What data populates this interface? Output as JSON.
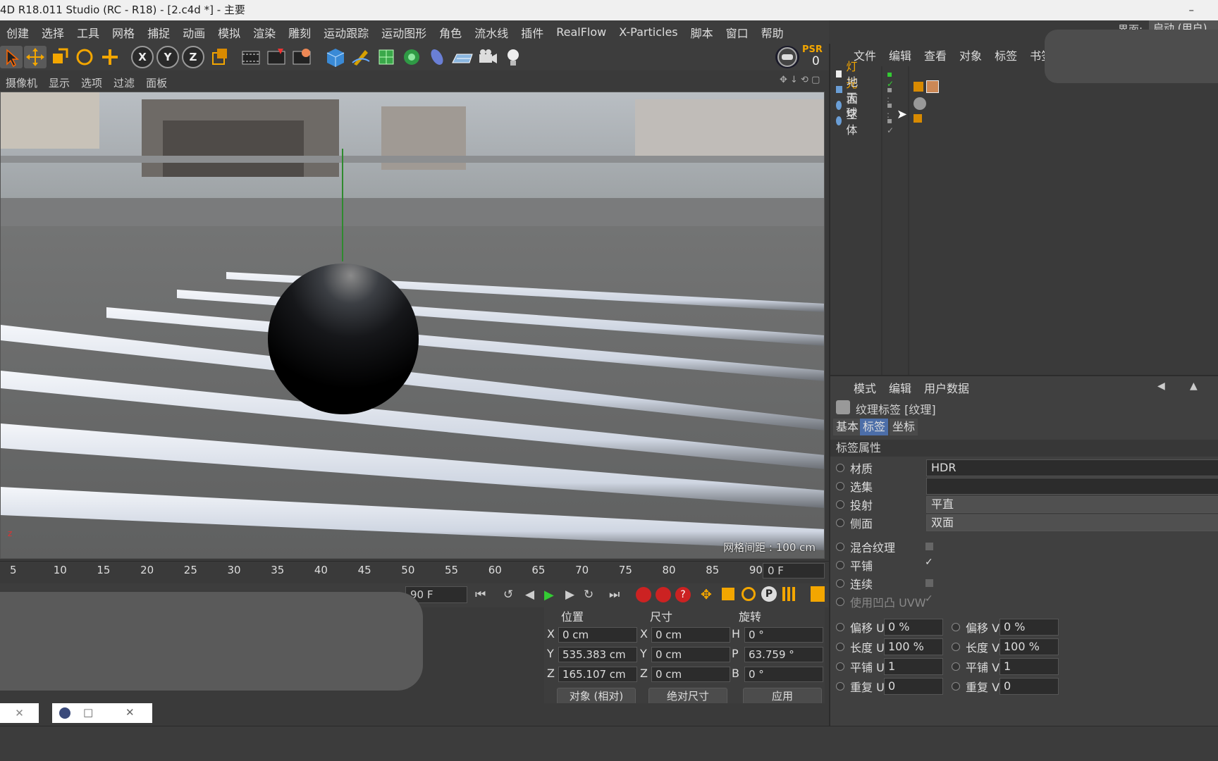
{
  "window": {
    "title": "4D R18.011 Studio (RC - R18) - [2.c4d *] - 主要",
    "minimize": "–"
  },
  "menu": [
    "创建",
    "选择",
    "工具",
    "网格",
    "捕捉",
    "动画",
    "模拟",
    "渲染",
    "雕刻",
    "运动跟踪",
    "运动图形",
    "角色",
    "流水线",
    "插件",
    "RealFlow",
    "X-Particles",
    "脚本",
    "窗口",
    "帮助"
  ],
  "layout_label": "界面:",
  "layout_value": "启动 (用户)",
  "toolbar": {
    "axis": [
      "X",
      "Y",
      "Z"
    ],
    "psr_label": "PSR",
    "psr_value": "0"
  },
  "viewport": {
    "menu": [
      "摄像机",
      "显示",
      "选项",
      "过滤",
      "面板"
    ],
    "grid_label": "网格间距 : 100 cm"
  },
  "timeline": {
    "ticks": [
      "5",
      "10",
      "15",
      "20",
      "25",
      "30",
      "35",
      "40",
      "45",
      "50",
      "55",
      "60",
      "65",
      "70",
      "75",
      "80",
      "85",
      "90"
    ],
    "current_frame": "0 F",
    "end_frame": "90 F"
  },
  "object_manager": {
    "menu": [
      "文件",
      "编辑",
      "查看",
      "对象",
      "标签",
      "书签"
    ],
    "objects": [
      {
        "name": "灯光",
        "highlight": true
      },
      {
        "name": "地面",
        "highlight": false
      },
      {
        "name": "天空",
        "highlight": false
      },
      {
        "name": "球体",
        "highlight": false
      }
    ]
  },
  "attribute_manager": {
    "menu": [
      "模式",
      "编辑",
      "用户数据"
    ],
    "header": "纹理标签 [纹理]",
    "tabs": [
      "基本",
      "标签",
      "坐标"
    ],
    "active_tab": 1,
    "section": "标签属性",
    "fields": [
      {
        "label": "材质",
        "value": "HDR"
      },
      {
        "label": "选集",
        "value": ""
      },
      {
        "label": "投射",
        "value": "平直"
      },
      {
        "label": "侧面",
        "value": "双面"
      }
    ],
    "checks": [
      {
        "label": "混合纹理",
        "checked": false
      },
      {
        "label": "平铺",
        "checked": true
      },
      {
        "label": "连续",
        "checked": false
      },
      {
        "label": "使用凹凸 UVW",
        "checked": true
      }
    ],
    "uv": [
      {
        "l1": "偏移 U",
        "v1": "0 %",
        "l2": "偏移 V",
        "v2": "0 %"
      },
      {
        "l1": "长度 U",
        "v1": "100 %",
        "l2": "长度 V",
        "v2": "100 %"
      },
      {
        "l1": "平铺 U",
        "v1": "1",
        "l2": "平铺 V",
        "v2": "1"
      },
      {
        "l1": "重复 U",
        "v1": "0",
        "l2": "重复 V",
        "v2": "0"
      }
    ]
  },
  "coordinates": {
    "headers": [
      "位置",
      "尺寸",
      "旋转"
    ],
    "rows": [
      {
        "a": "X",
        "pos": "0 cm",
        "b": "X",
        "size": "0 cm",
        "c": "H",
        "rot": "0 °"
      },
      {
        "a": "Y",
        "pos": "535.383 cm",
        "b": "Y",
        "size": "0 cm",
        "c": "P",
        "rot": "63.759 °"
      },
      {
        "a": "Z",
        "pos": "165.107 cm",
        "b": "Z",
        "size": "0 cm",
        "c": "B",
        "rot": "0 °"
      }
    ],
    "mode_object": "对象 (相对)",
    "mode_size": "绝对尺寸",
    "apply": "应用"
  },
  "taskbar": {
    "close": "✕",
    "square": "□"
  }
}
